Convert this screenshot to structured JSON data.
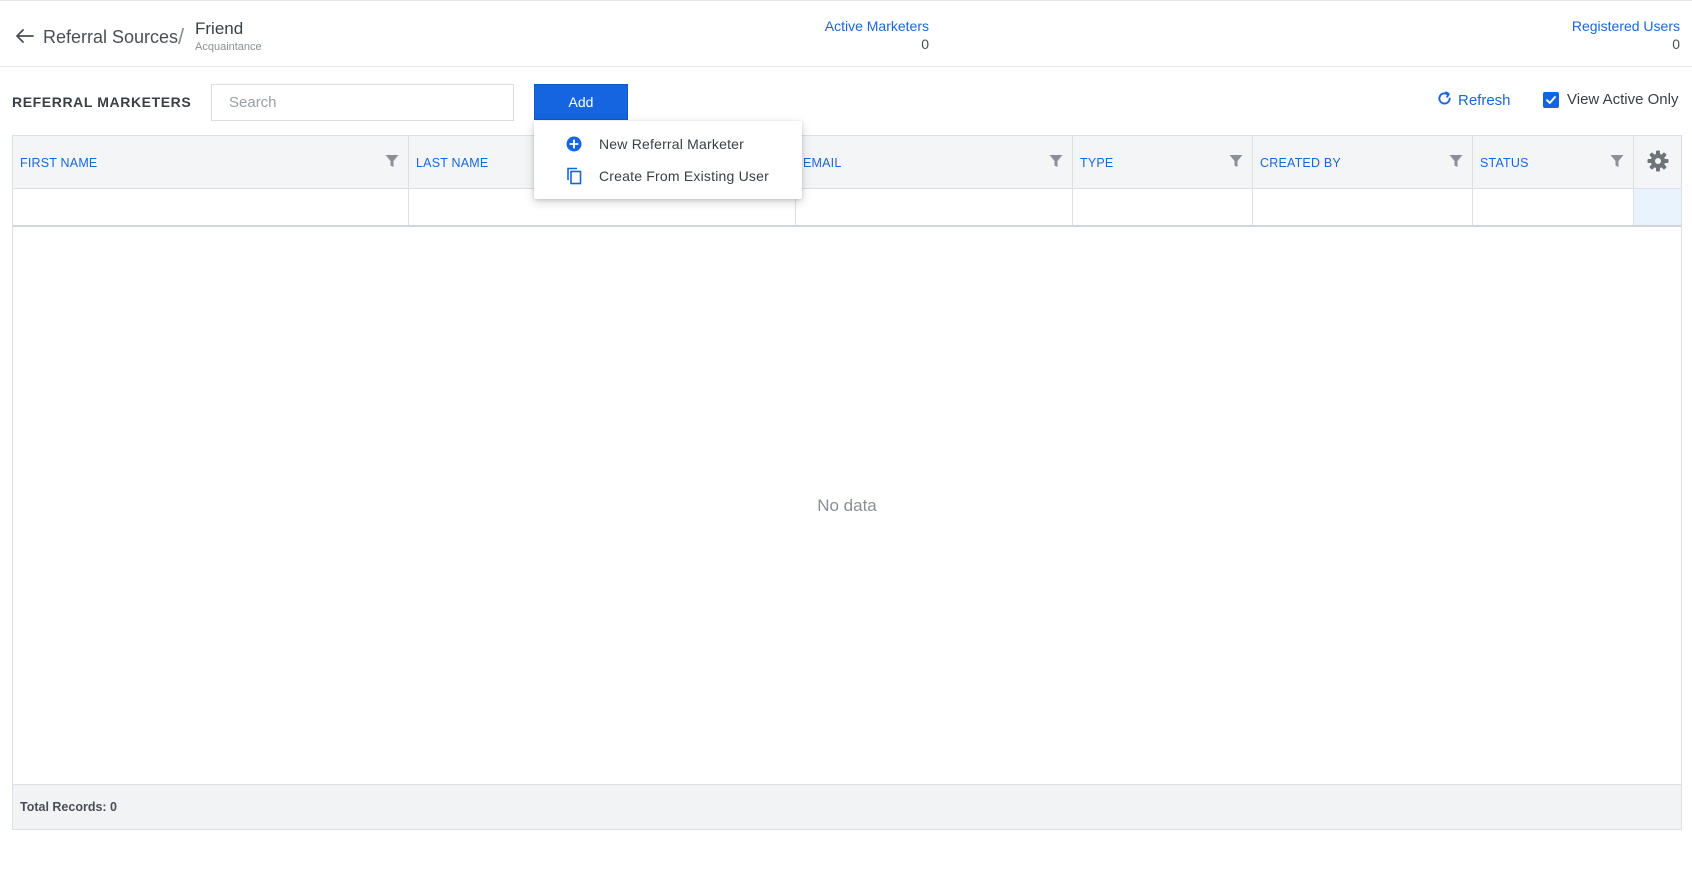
{
  "header": {
    "breadcrumb_root": "Referral Sources",
    "breadcrumb_separator": "/",
    "title": "Friend",
    "subtitle": "Acquaintance",
    "stats": [
      {
        "label": "Active Marketers",
        "value": "0"
      },
      {
        "label": "Registered Users",
        "value": "0"
      }
    ]
  },
  "toolbar": {
    "section_title": "REFERRAL MARKETERS",
    "search_placeholder": "Search",
    "search_value": "",
    "add_label": "Add",
    "refresh_label": "Refresh",
    "view_active_only_label": "View Active Only",
    "view_active_only_checked": true
  },
  "add_menu": {
    "items": [
      {
        "label": "New Referral Marketer",
        "icon": "plus-circle-icon"
      },
      {
        "label": "Create From Existing User",
        "icon": "copy-icon"
      }
    ]
  },
  "grid": {
    "columns": [
      {
        "label": "FIRST NAME"
      },
      {
        "label": "LAST NAME"
      },
      {
        "label": "EMAIL"
      },
      {
        "label": "TYPE"
      },
      {
        "label": "CREATED BY"
      },
      {
        "label": "STATUS"
      }
    ],
    "rows": [],
    "empty_text": "No data",
    "footer_text": "Total Records: 0",
    "settings_icon": "gear-icon"
  },
  "colors": {
    "accent": "#1565e0",
    "link": "#1a66d9",
    "text": "#3a3f44",
    "muted": "#8a8f95"
  }
}
